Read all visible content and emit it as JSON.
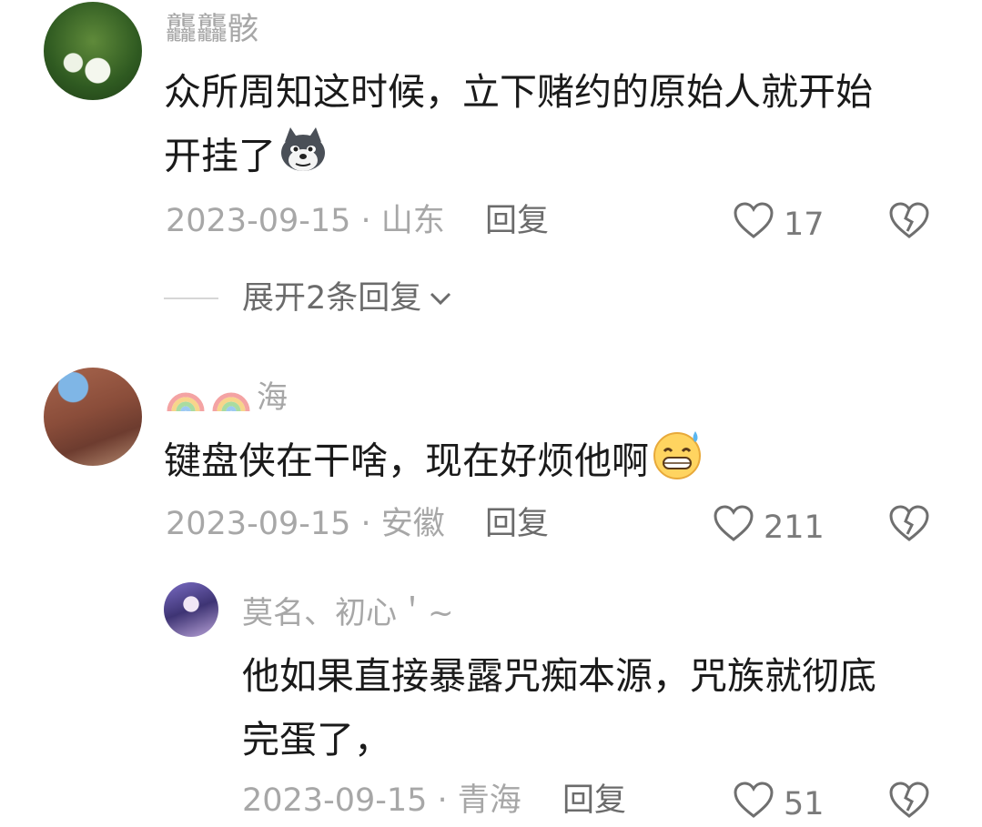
{
  "comments": [
    {
      "username": "龘龘骸",
      "text_line1": "众所周知这时候，立下赌约的原始人就开始",
      "text_line2": "开挂了",
      "emoji": "wolf-face-emoji",
      "date_location": "2023-09-15 · 山东",
      "reply_label": "回复",
      "likes": "17",
      "expand_label": "展开2条回复"
    },
    {
      "username": "海",
      "username_prefix_icons": [
        "rainbow-icon",
        "rainbow-icon"
      ],
      "text_line1": "键盘侠在干啥，现在好烦他啊",
      "emoji": "grinning-sweat-emoji",
      "date_location": "2023-09-15 · 安徽",
      "reply_label": "回复",
      "likes": "211"
    },
    {
      "username": "莫名、初心＇~",
      "text_line1": "他如果直接暴露咒痴本源，咒族就彻底",
      "text_line2": "完蛋了，",
      "date_location": "2023-09-15 · 青海",
      "reply_label": "回复",
      "likes": "51"
    }
  ],
  "colors": {
    "meta_gray": "#a7a7a7",
    "body_text": "#1a1a1a",
    "reply_gray": "#6b6b6b"
  }
}
